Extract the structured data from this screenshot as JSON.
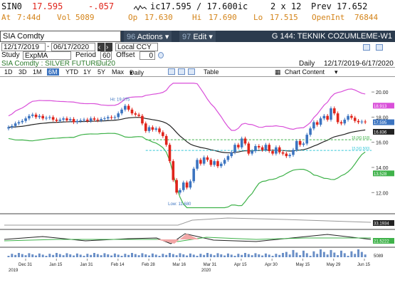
{
  "quote": {
    "ticker": "SIN0",
    "last": "17.595",
    "change": "-.057",
    "bid_ask": "ic17.595 / 17.600ic",
    "size": "2 x 12",
    "prev_label": "Prev",
    "prev": "17.652",
    "time_label": "At",
    "time": "7:44d",
    "vol_label": "Vol",
    "vol": "5089",
    "open_label": "Op",
    "open": "17.630",
    "high_label": "Hi",
    "high": "17.690",
    "low_label": "Lo",
    "low": "17.515",
    "oi_label": "OpenInt",
    "oi": "76844"
  },
  "titlebar": {
    "security": "SIA Comdty",
    "num_actions": "96",
    "actions": "Actions",
    "num_edit": "97",
    "edit": "Edit",
    "page": "G 144: TEKNIK COZUMLEME-W1"
  },
  "options": {
    "start_date": "12/17/2019",
    "end_date": "06/17/2020",
    "currency": "Local CCY",
    "study_label": "Study",
    "study": "ExpMA",
    "period_label": "Period",
    "period": "60",
    "offset_label": "Offset",
    "offset": "0"
  },
  "info": {
    "name": "SIA Comdty : SILVER FUTURE",
    "contract": "Jul20",
    "freq": "Daily",
    "range": "12/17/2019-6/17/2020"
  },
  "toolbar": {
    "periods": [
      "1D",
      "3D",
      "1M",
      "6M",
      "YTD",
      "1Y",
      "5Y",
      "Max"
    ],
    "selected": "6M",
    "freq": "Daily",
    "table": "Table",
    "chart_content": "Chart Content"
  },
  "chart_data": {
    "type": "line",
    "series_type": "candlestick",
    "ylim": [
      10.6,
      20.8
    ],
    "yticks": [
      12,
      14,
      16,
      18,
      20
    ],
    "ytick_labels": [
      "12.00",
      "14.00",
      "16.00",
      "18.00",
      "20.00"
    ],
    "xticks": [
      "Dec 31",
      "Jan 15",
      "Jan 31",
      "Feb 14",
      "Feb 28",
      "Mar 16",
      "Mar 31",
      "Apr 15",
      "Apr 30",
      "May 15",
      "May 29",
      "Jun 15"
    ],
    "xyears": [
      "2019",
      "2020"
    ],
    "annotations": [
      {
        "text": "Hi: 19.075",
        "value": 19.075
      },
      {
        "text": "Low: 11.680",
        "value": 11.68
      }
    ],
    "right_labels": [
      {
        "text": "18.913",
        "value": 18.913,
        "color": "#d94fd9"
      },
      {
        "text": "17.595",
        "value": 17.595,
        "color": "#3c74c0"
      },
      {
        "text": "16.836",
        "value": 16.836,
        "color": "#222222"
      },
      {
        "text": "13.528",
        "value": 13.528,
        "color": "#3fb24a"
      }
    ],
    "hline_labels": [
      {
        "text": "16.0(0.618)",
        "value": 16.2
      },
      {
        "text": "15.5(0.500)",
        "value": 15.35
      }
    ],
    "closes": [
      17.2,
      17.3,
      17.5,
      17.6,
      17.7,
      17.9,
      18.1,
      18.2,
      18.0,
      18.1,
      17.9,
      17.95,
      18.0,
      17.8,
      17.7,
      17.8,
      17.9,
      17.75,
      17.85,
      17.6,
      17.7,
      17.75,
      17.8,
      17.7,
      17.9,
      17.8,
      17.75,
      17.85,
      17.9,
      18.0,
      17.95,
      18.0,
      18.3,
      18.6,
      18.9,
      18.6,
      18.3,
      18.2,
      18.1,
      17.5,
      16.9,
      17.2,
      17.0,
      17.1,
      16.8,
      16.5,
      15.8,
      14.5,
      13.0,
      12.0,
      12.2,
      12.8,
      12.4,
      12.9,
      13.9,
      14.6,
      14.3,
      14.8,
      14.6,
      14.2,
      14.5,
      14.1,
      14.3,
      14.6,
      14.9,
      15.2,
      15.8,
      15.6,
      16.3,
      15.9,
      15.1,
      15.3,
      15.7,
      15.6,
      15.4,
      15.8,
      15.3,
      15.1,
      15.6,
      15.2,
      15.1,
      14.9,
      15.0,
      15.4,
      16.1,
      15.8,
      15.9,
      16.6,
      17.1,
      17.6,
      17.4,
      17.9,
      18.1,
      17.8,
      18.7,
      18.3,
      17.6,
      17.5,
      17.8,
      18.1,
      17.95,
      17.7,
      17.6,
      17.65,
      17.6
    ],
    "legend": "none",
    "grid": false
  },
  "lower_panels": {
    "p1_label": "33.1934",
    "p2_label": "21.5222",
    "p3_label": "5089"
  },
  "colors": {
    "up": "#3c74c0",
    "down": "#e0241b",
    "upper_band": "#d94fd9",
    "lower_band": "#3fb24a",
    "ema": "#222222",
    "hline_green": "#3fb24a",
    "hline_cyan": "#36c8d8",
    "accent": "#d4841a"
  }
}
